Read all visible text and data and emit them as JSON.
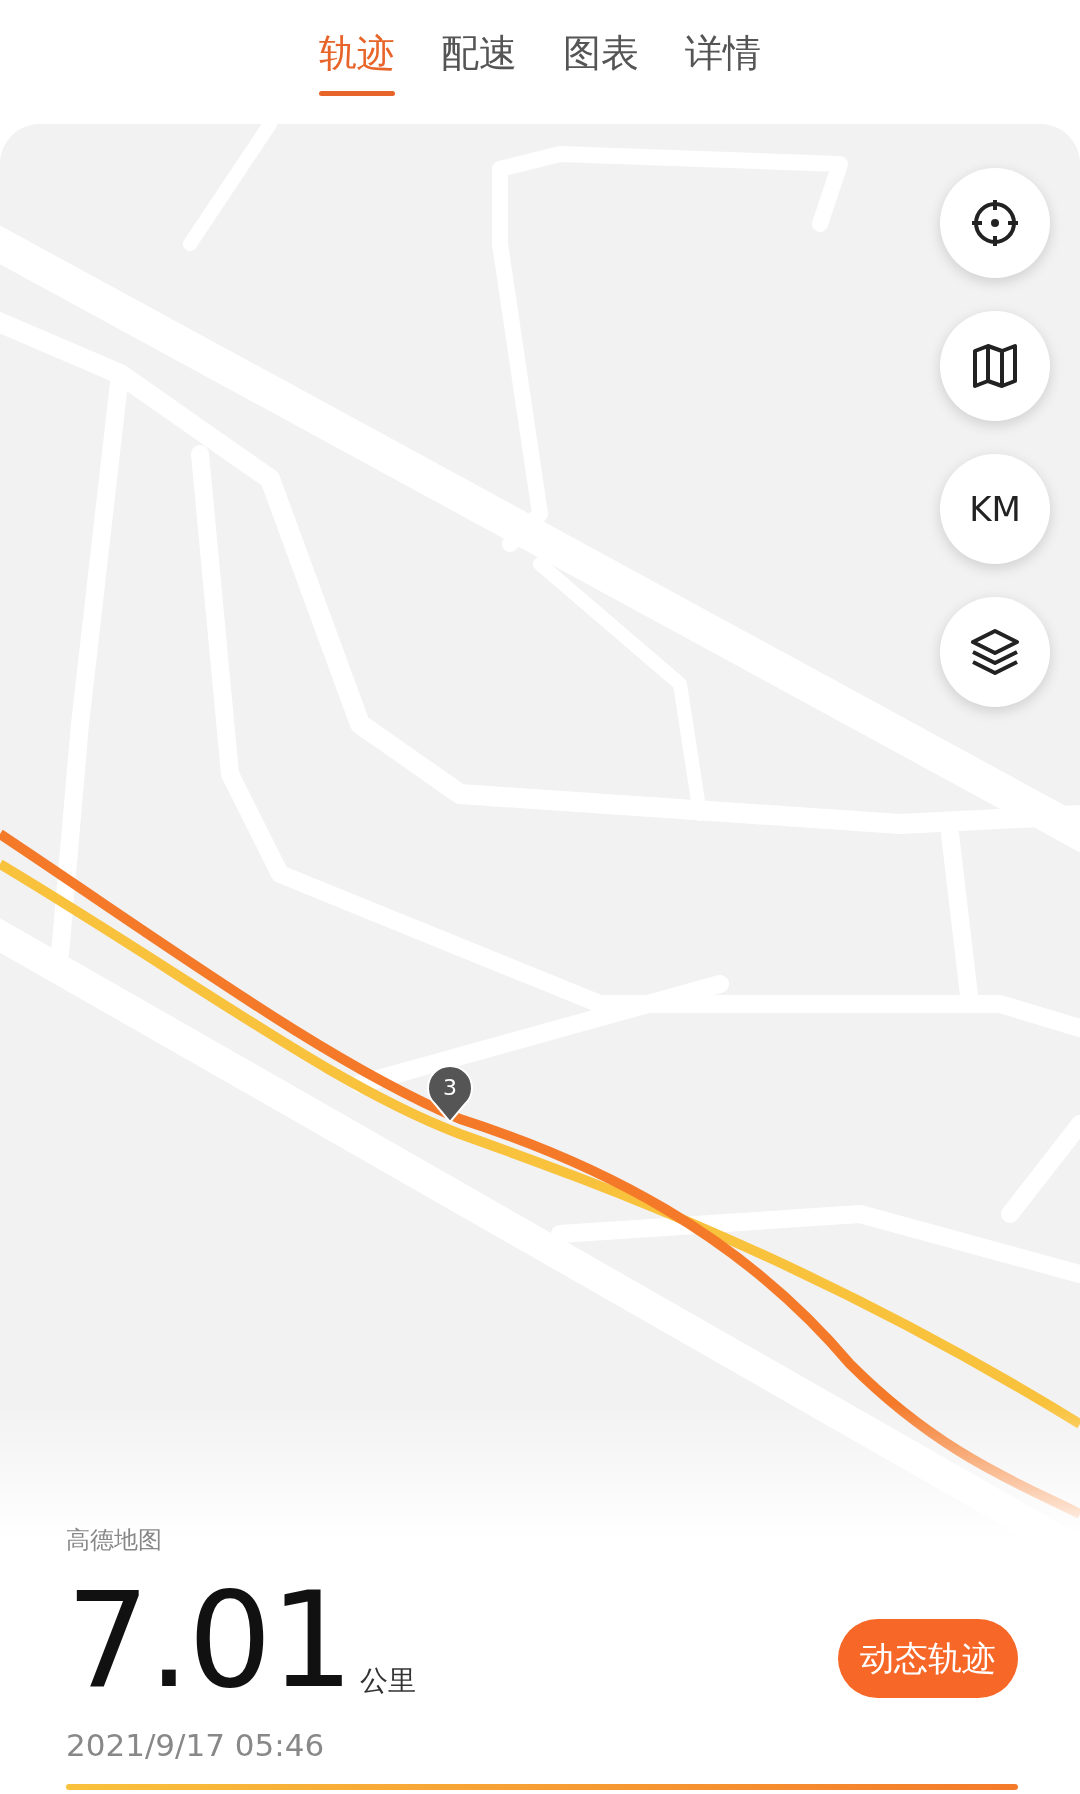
{
  "tabs": [
    {
      "label": "轨迹",
      "selected": true
    },
    {
      "label": "配速",
      "selected": false
    },
    {
      "label": "图表",
      "selected": false
    },
    {
      "label": "详情",
      "selected": false
    }
  ],
  "map": {
    "km_marker": "3",
    "controls": [
      {
        "kind": "locate"
      },
      {
        "kind": "map"
      },
      {
        "kind": "text",
        "label": "KM"
      },
      {
        "kind": "layers"
      }
    ],
    "attribution": "高德地图"
  },
  "summary": {
    "distance": "7.01",
    "unit": "公里",
    "date": "2021/9/17 05:46",
    "button": "动态轨迹"
  }
}
